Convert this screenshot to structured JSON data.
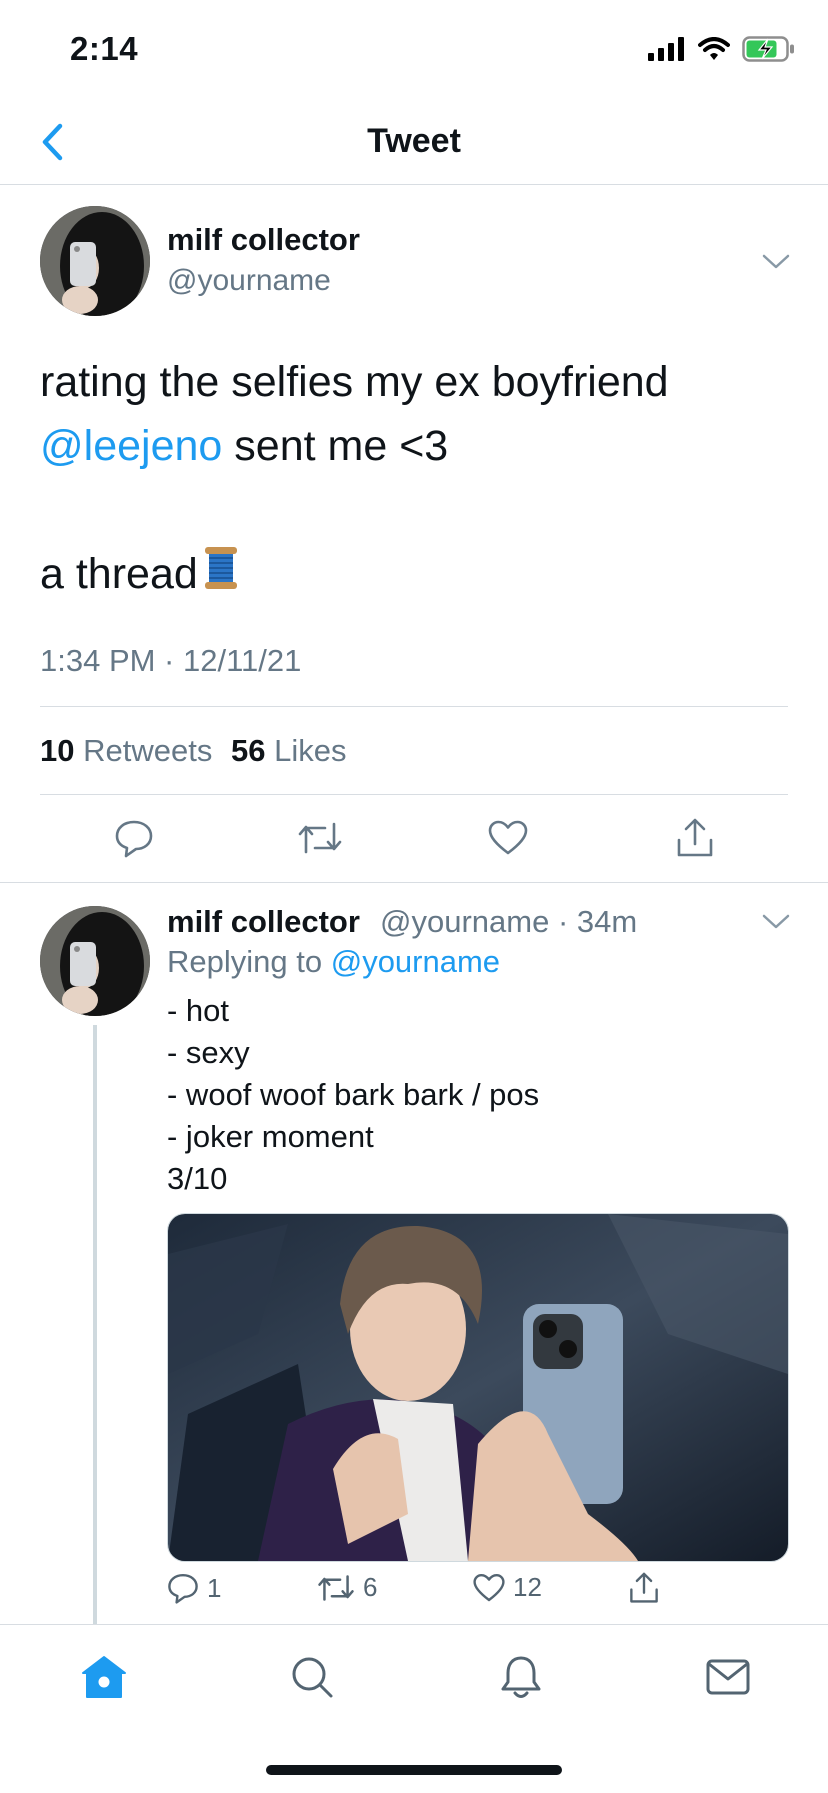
{
  "status_bar": {
    "time": "2:14"
  },
  "nav": {
    "title": "Tweet"
  },
  "tweet": {
    "display_name": "milf collector",
    "handle": "@yourname",
    "text_line1": "rating the selfies my ex boyfriend",
    "mention": "@leejeno",
    "text_line2_rest": " sent me <3",
    "text_line3": "a thread",
    "emoji": "thread-spool-emoji",
    "timestamp": "1:34 PM · 12/11/21",
    "retweets_count": "10",
    "retweets_label": "Retweets",
    "likes_count": "56",
    "likes_label": "Likes"
  },
  "reply": {
    "display_name": "milf collector",
    "handle": "@yourname",
    "age": "34m",
    "replying_prefix": "Replying to",
    "replying_handle": "@yourname",
    "lines": [
      "- hot",
      "- sexy",
      "- woof woof bark bark / pos",
      "- joker moment",
      "3/10"
    ],
    "reply_count": "1",
    "retweet_count": "6",
    "like_count": "12"
  },
  "tab_bar": {
    "items": [
      "home-icon",
      "search-icon",
      "notifications-icon",
      "messages-icon"
    ],
    "active": "home-icon"
  },
  "colors": {
    "accent": "#1d9bf0",
    "secondary_text": "#657786",
    "divider": "#d8dde2"
  }
}
